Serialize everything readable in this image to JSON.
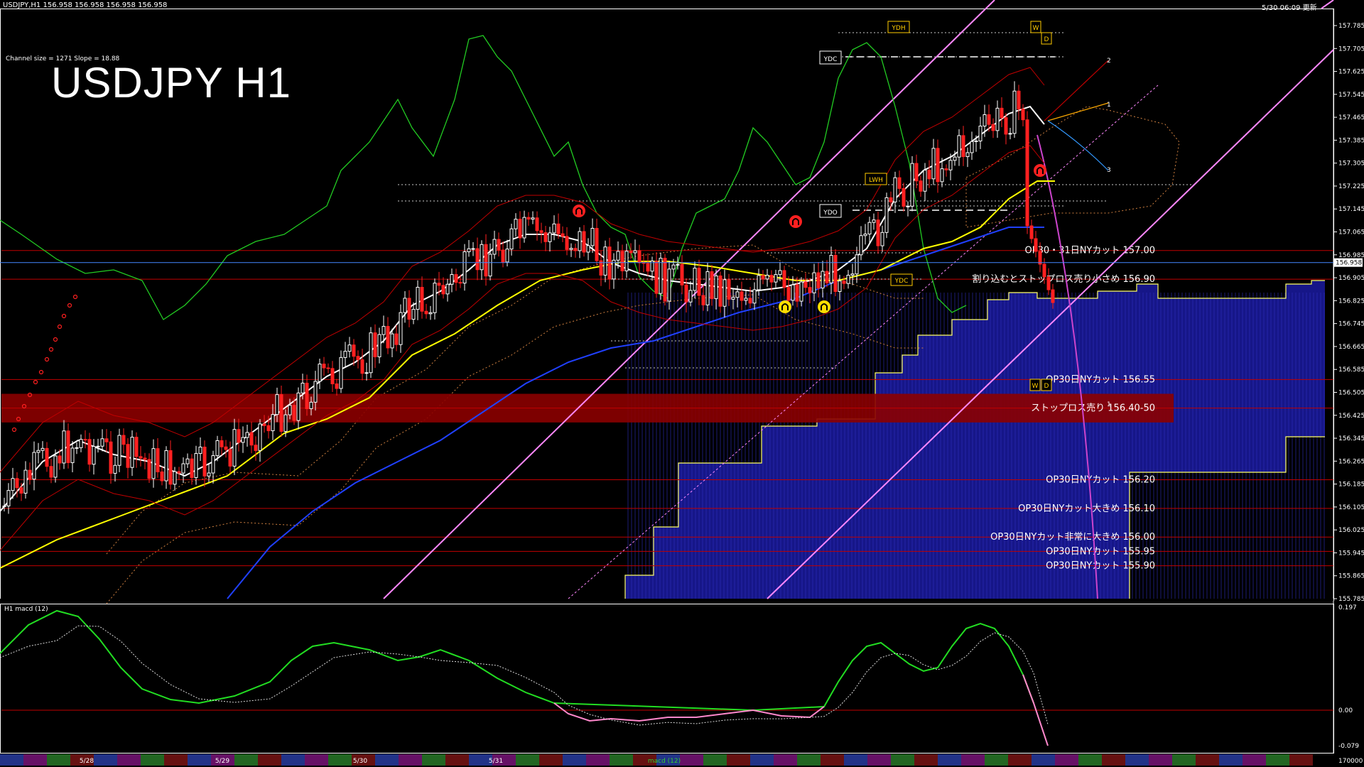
{
  "header": {
    "symbol_info": "USDJPY,H1  156.958 156.958 156.958 156.958",
    "timestamp": "5/30 06:09 更新",
    "channel_info": "Channel size = 1271 Slope = 18.88",
    "chart_title": "USDJPY H1",
    "macd_label": "H1  macd (12)"
  },
  "colors": {
    "background": "#000000",
    "up_candle": "#ffffff",
    "down_candle": "#ff2020",
    "level_line": "#c00000",
    "stop_zone": "#8b0000",
    "cloud_fill": "#1a1aa0",
    "ma_white": "#ffffff",
    "ma_yellow": "#ffff00",
    "ma_blue": "#2040ff",
    "chikou_green": "#22cc22",
    "channel_pink": "#ff88ff",
    "macd_green": "#22dd22",
    "macd_pink": "#ff88cc",
    "axis_bg": "#ffffff"
  },
  "chart_data": {
    "type": "candlestick",
    "ylim": [
      155.75,
      157.785
    ],
    "y_ticks": [
      "157.785",
      "157.705",
      "157.625",
      "157.545",
      "157.465",
      "157.385",
      "157.305",
      "157.225",
      "157.145",
      "157.065",
      "156.985",
      "156.905",
      "156.825",
      "156.745",
      "156.665",
      "156.585",
      "156.505",
      "156.425",
      "156.345",
      "156.265",
      "156.185",
      "156.105",
      "156.025",
      "155.945",
      "155.865",
      "155.785"
    ],
    "current_price": "156.958",
    "date_labels": [
      "5/28",
      "5/29",
      "5/30",
      "5/31"
    ],
    "macd_ticks": [
      "0.197",
      "0.00",
      "-0.079"
    ],
    "macd_bottom_label": "170000",
    "annotations": [
      "YDH",
      "W",
      "D",
      "YDC",
      "YDO",
      "LWH",
      "YDC",
      "W",
      "D"
    ],
    "fib_labels": [
      "2",
      "1",
      "3",
      "1"
    ],
    "levels": [
      {
        "label": "OP30・31日NYカット 157.00",
        "price": 157.0
      },
      {
        "label": "割り込むとストップロス売り小さめ 156.90",
        "price": 156.9
      },
      {
        "label": "OP30日NYカット 156.55",
        "price": 156.55
      },
      {
        "label": "ストップロス売り 156.40-50",
        "price": 156.45
      },
      {
        "label": "OP30日NYカット 156.20",
        "price": 156.2
      },
      {
        "label": "OP30日NYカット大きめ 156.10",
        "price": 156.1
      },
      {
        "label": "OP30日NYカット非常に大きめ 156.00",
        "price": 156.0
      },
      {
        "label": "OP30日NYカット 155.95",
        "price": 155.95
      },
      {
        "label": "OP30日NYカット 155.90",
        "price": 155.9
      }
    ]
  },
  "bottom_bar": {
    "indicator_tag": "macd (12)"
  }
}
